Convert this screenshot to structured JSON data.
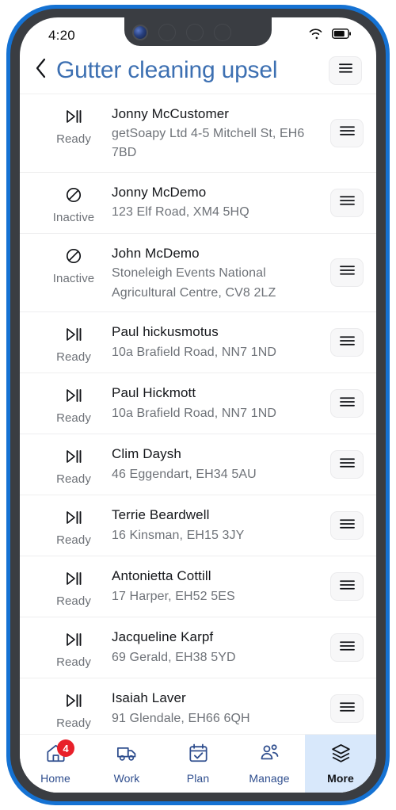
{
  "status_bar": {
    "time": "4:20",
    "wifi_icon": "wifi-icon",
    "battery_icon": "battery-icon"
  },
  "header": {
    "back_icon": "chevron-left-icon",
    "title": "Gutter cleaning upsel",
    "menu_icon": "hamburger-menu-icon",
    "title_color": "#3d70b2"
  },
  "list": {
    "row_action_icon": "hamburger-menu-icon",
    "rows": [
      {
        "status": "Ready",
        "status_icon": "play-pause-icon",
        "name": "Jonny McCustomer",
        "address": "getSoapy Ltd 4-5 Mitchell St, EH6 7BD"
      },
      {
        "status": "Inactive",
        "status_icon": "prohibited-icon",
        "name": "Jonny McDemo",
        "address": "123 Elf Road, XM4 5HQ"
      },
      {
        "status": "Inactive",
        "status_icon": "prohibited-icon",
        "name": "John McDemo",
        "address": "Stoneleigh Events National Agricultural Centre, CV8 2LZ"
      },
      {
        "status": "Ready",
        "status_icon": "play-pause-icon",
        "name": "Paul hickusmotus",
        "address": "10a Brafield Road, NN7 1ND"
      },
      {
        "status": "Ready",
        "status_icon": "play-pause-icon",
        "name": "Paul Hickmott",
        "address": "10a Brafield Road, NN7 1ND"
      },
      {
        "status": "Ready",
        "status_icon": "play-pause-icon",
        "name": "Clim Daysh",
        "address": "46 Eggendart, EH34 5AU"
      },
      {
        "status": "Ready",
        "status_icon": "play-pause-icon",
        "name": "Terrie Beardwell",
        "address": "16 Kinsman, EH15 3JY"
      },
      {
        "status": "Ready",
        "status_icon": "play-pause-icon",
        "name": "Antonietta Cottill",
        "address": "17 Harper, EH52 5ES"
      },
      {
        "status": "Ready",
        "status_icon": "play-pause-icon",
        "name": "Jacqueline Karpf",
        "address": "69 Gerald, EH38 5YD"
      },
      {
        "status": "Ready",
        "status_icon": "play-pause-icon",
        "name": "Isaiah Laver",
        "address": "91 Glendale, EH66 6QH"
      }
    ]
  },
  "bottom_nav": {
    "active_bg": "#d8e8fb",
    "badge_color": "#e8202a",
    "items": [
      {
        "label": "Home",
        "icon": "home-icon",
        "badge": "4",
        "active": false
      },
      {
        "label": "Work",
        "icon": "truck-icon",
        "badge": null,
        "active": false
      },
      {
        "label": "Plan",
        "icon": "calendar-check-icon",
        "badge": null,
        "active": false
      },
      {
        "label": "Manage",
        "icon": "people-group-icon",
        "badge": null,
        "active": false
      },
      {
        "label": "More",
        "icon": "layers-icon",
        "badge": null,
        "active": true
      }
    ]
  }
}
